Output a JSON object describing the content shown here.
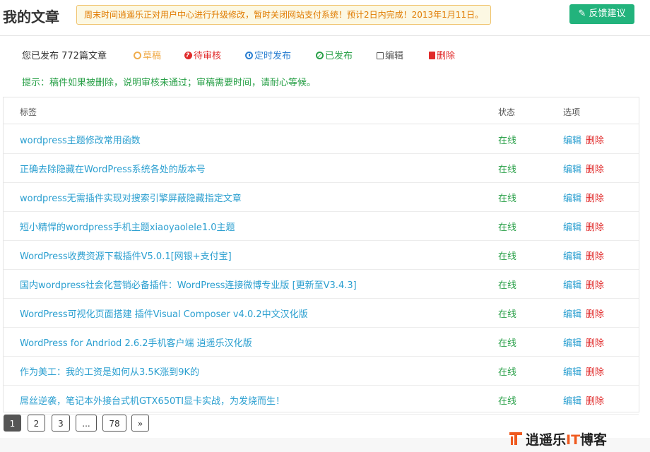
{
  "header": {
    "title": "我的文章",
    "notice": "周末时间逍遥乐正对用户中心进行升级修改，暂时关闭网站支付系统！预计2日内完成！2013年1月11日。",
    "feedback_button": "反馈建议"
  },
  "stats": {
    "published_summary": "您已发布 772篇文章",
    "draft": "草稿",
    "pending": "待审核",
    "scheduled": "定时发布",
    "published": "已发布",
    "edit": "编辑",
    "delete": "删除"
  },
  "hint": "提示：稿件如果被删除，说明审核未通过；审稿需要时间，请耐心等候。",
  "table": {
    "columns": [
      "标签",
      "状态",
      "选项"
    ],
    "rows": [
      {
        "title": "wordpress主题修改常用函数",
        "status": "在线",
        "edit": "编辑",
        "delete": "删除"
      },
      {
        "title": "正确去除隐藏在WordPress系统各处的版本号",
        "status": "在线",
        "edit": "编辑",
        "delete": "删除"
      },
      {
        "title": "wordpress无需插件实现对搜索引擎屏蔽隐藏指定文章",
        "status": "在线",
        "edit": "编辑",
        "delete": "删除"
      },
      {
        "title": "短小精悍的wordpress手机主题xiaoyaolele1.0主题",
        "status": "在线",
        "edit": "编辑",
        "delete": "删除"
      },
      {
        "title": "WordPress收费资源下载插件V5.0.1[网银+支付宝]",
        "status": "在线",
        "edit": "编辑",
        "delete": "删除"
      },
      {
        "title": "国内wordpress社会化营销必备插件：WordPress连接微博专业版 [更新至V3.4.3]",
        "status": "在线",
        "edit": "编辑",
        "delete": "删除"
      },
      {
        "title": "WordPress可视化页面搭建 插件Visual Composer v4.0.2中文汉化版",
        "status": "在线",
        "edit": "编辑",
        "delete": "删除"
      },
      {
        "title": "WordPress for Andriod 2.6.2手机客户端 逍遥乐汉化版",
        "status": "在线",
        "edit": "编辑",
        "delete": "删除"
      },
      {
        "title": "作为美工：我的工资是如何从3.5K涨到9K的",
        "status": "在线",
        "edit": "编辑",
        "delete": "删除"
      },
      {
        "title": "屌丝逆袭，笔记本外接台式机GTX650TI显卡实战，为发烧而生！",
        "status": "在线",
        "edit": "编辑",
        "delete": "删除"
      }
    ]
  },
  "pagination": {
    "pages": [
      "1",
      "2",
      "3",
      "...",
      "78",
      "»"
    ],
    "active": "1"
  },
  "watermark": {
    "text_main": "逍遥乐",
    "text_it": "IT",
    "text_end": "博客"
  },
  "colors": {
    "accent_green": "#22b37c",
    "link_blue": "#2b9fd0",
    "status_green": "#29a048",
    "delete_red": "#e02a2a",
    "notice_orange": "#e07b00"
  }
}
